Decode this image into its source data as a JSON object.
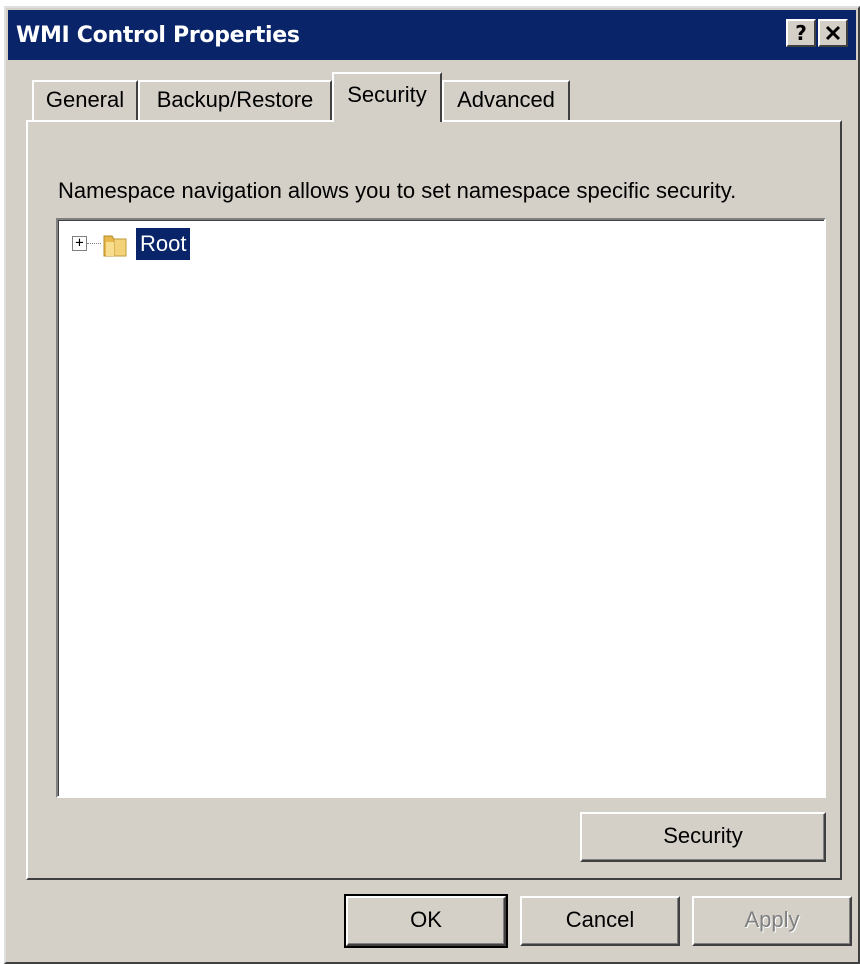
{
  "window": {
    "title": "WMI Control Properties",
    "help_label": "?",
    "close_label": "✕"
  },
  "tabs": [
    {
      "label": "General",
      "active": false
    },
    {
      "label": "Backup/Restore",
      "active": false
    },
    {
      "label": "Security",
      "active": true
    },
    {
      "label": "Advanced",
      "active": false
    }
  ],
  "security_tab": {
    "description": "Namespace navigation allows you to set namespace specific security.",
    "tree": {
      "items": [
        {
          "label": "Root",
          "expander": "+",
          "icon": "folder-icon",
          "selected": true
        }
      ]
    },
    "security_button_label": "Security"
  },
  "footer": {
    "ok_label": "OK",
    "cancel_label": "Cancel",
    "apply_label": "Apply"
  },
  "colors": {
    "titlebar": "#0a246a",
    "face": "#d4d0c8",
    "selection": "#0a246a"
  }
}
